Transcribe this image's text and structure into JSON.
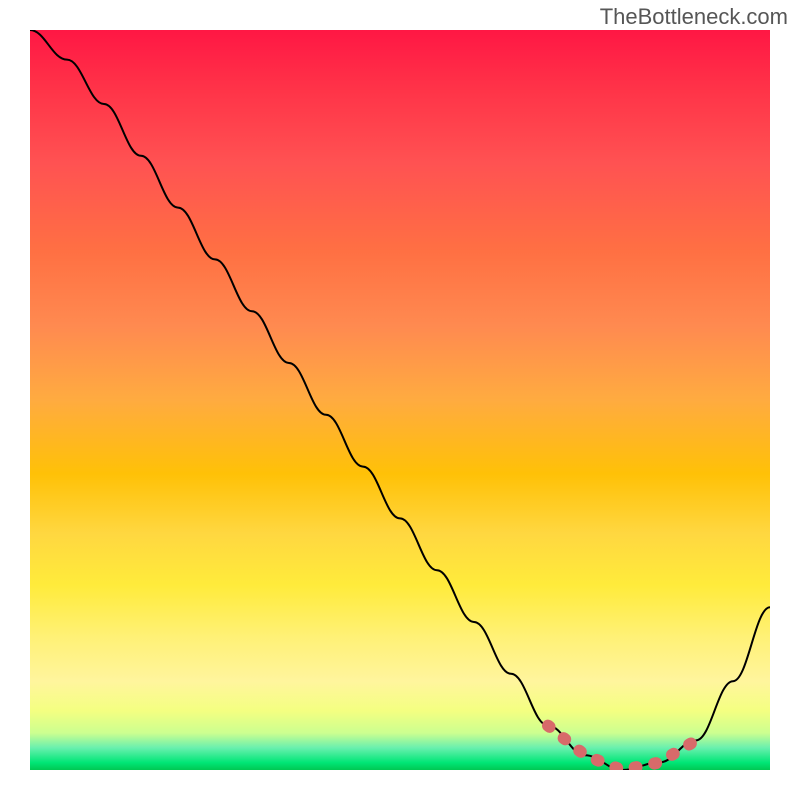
{
  "watermark": "TheBottleneck.com",
  "chart_data": {
    "type": "line",
    "title": "",
    "xlabel": "",
    "ylabel": "",
    "x": [
      0,
      5,
      10,
      15,
      20,
      25,
      30,
      35,
      40,
      45,
      50,
      55,
      60,
      65,
      70,
      75,
      80,
      85,
      90,
      95,
      100
    ],
    "values": [
      100,
      96,
      90,
      83,
      76,
      69,
      62,
      55,
      48,
      41,
      34,
      27,
      20,
      13,
      6,
      2,
      0,
      1,
      4,
      12,
      22
    ],
    "optimal_range": {
      "x_start": 70,
      "x_end": 90,
      "y_level": 1
    },
    "xlim": [
      0,
      100
    ],
    "ylim": [
      0,
      100
    ],
    "background_gradient": {
      "top": "#ff1744",
      "middle": "#ffd740",
      "bottom": "#00e676"
    },
    "highlight_color": "#e57373",
    "curve_color": "#000000"
  }
}
